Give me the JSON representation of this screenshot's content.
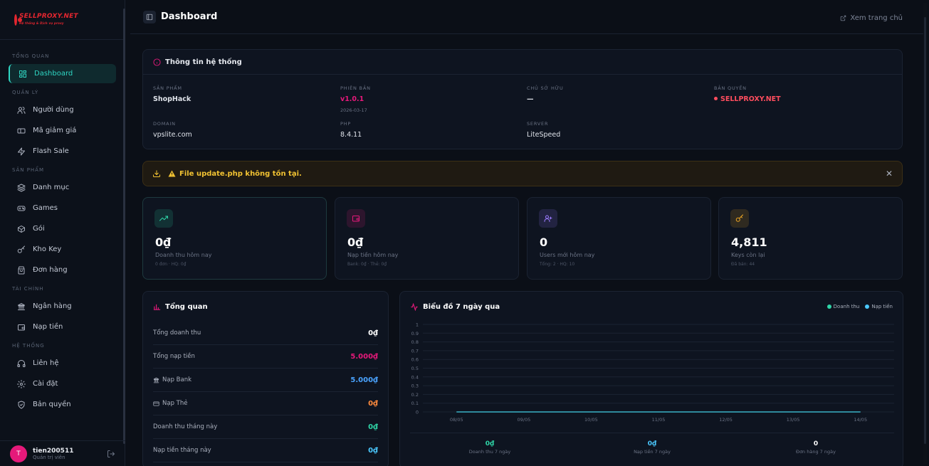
{
  "sidebar": {
    "logo_text": "SELLPROXY.NET",
    "logo_sub": "Hệ thống & Dịch vụ proxy",
    "sections": [
      {
        "title": "TỔNG QUAN",
        "items": [
          {
            "label": "Dashboard",
            "icon": "dashboard-icon",
            "active": true
          }
        ]
      },
      {
        "title": "QUẢN LÝ",
        "items": [
          {
            "label": "Người dùng",
            "icon": "users-icon"
          },
          {
            "label": "Mã giảm giá",
            "icon": "ticket-icon"
          },
          {
            "label": "Flash Sale",
            "icon": "flash-icon"
          }
        ]
      },
      {
        "title": "SẢN PHẨM",
        "items": [
          {
            "label": "Danh mục",
            "icon": "layers-icon"
          },
          {
            "label": "Games",
            "icon": "gamepad-icon"
          },
          {
            "label": "Gói",
            "icon": "package-icon"
          },
          {
            "label": "Kho Key",
            "icon": "key-icon"
          },
          {
            "label": "Đơn hàng",
            "icon": "bag-icon"
          }
        ]
      },
      {
        "title": "TÀI CHÍNH",
        "items": [
          {
            "label": "Ngân hàng",
            "icon": "bank-icon"
          },
          {
            "label": "Nạp tiền",
            "icon": "wallet-icon"
          }
        ]
      },
      {
        "title": "HỆ THỐNG",
        "items": [
          {
            "label": "Liên hệ",
            "icon": "headset-icon"
          },
          {
            "label": "Cài đặt",
            "icon": "gear-icon"
          },
          {
            "label": "Bản quyền",
            "icon": "shield-icon"
          }
        ]
      }
    ],
    "user": {
      "initial": "T",
      "name": "tien200511",
      "role": "Quản trị viên"
    }
  },
  "topbar": {
    "title": "Dashboard",
    "home_link": "Xem trang chủ"
  },
  "info": {
    "title": "Thông tin hệ thống",
    "product_label": "SẢN PHẨM",
    "product": "ShopHack",
    "version_label": "PHIÊN BẢN",
    "version": "v1.0.1",
    "version_date": "2026-03-17",
    "owner_label": "CHỦ SỞ HỮU",
    "owner": "—",
    "license_label": "BẢN QUYỀN",
    "license": "SELLPROXY.NET",
    "domain_label": "DOMAIN",
    "domain": "vpslite.com",
    "php_label": "PHP",
    "php": "8.4.11",
    "server_label": "SERVER",
    "server": "LiteSpeed"
  },
  "alert": {
    "message": "File update.php không tồn tại."
  },
  "stats": [
    {
      "value": "0₫",
      "label": "Doanh thu hôm nay",
      "sub": "0 đơn · HQ: 0₫",
      "icon": "trending-up-icon",
      "color": "#2fd6a8"
    },
    {
      "value": "0₫",
      "label": "Nạp tiền hôm nay",
      "sub": "Bank: 0₫ · Thẻ: 0₫",
      "icon": "wallet-icon",
      "color": "#e5197a"
    },
    {
      "value": "0",
      "label": "Users mới hôm nay",
      "sub": "Tổng: 2 · HQ: 10",
      "icon": "user-plus-icon",
      "color": "#9b7bff"
    },
    {
      "value": "4,811",
      "label": "Keys còn lại",
      "sub": "Đã bán: 44",
      "icon": "key-icon",
      "color": "#f1a824"
    }
  ],
  "overview": {
    "title": "Tổng quan",
    "rows": [
      {
        "label": "Tổng doanh thu",
        "value": "0₫",
        "color": "#ffffff",
        "icon": ""
      },
      {
        "label": "Tổng nạp tiền",
        "value": "5.000₫",
        "color": "#e5197a",
        "icon": ""
      },
      {
        "label": "Nạp Bank",
        "value": "5.000₫",
        "color": "#4aa3ff",
        "icon": "bank-icon"
      },
      {
        "label": "Nạp Thẻ",
        "value": "0₫",
        "color": "#ff8a3d",
        "icon": "card-icon"
      },
      {
        "label": "Doanh thu tháng này",
        "value": "0₫",
        "color": "#2fd6a8",
        "icon": ""
      },
      {
        "label": "Nạp tiền tháng này",
        "value": "0₫",
        "color": "#4ac8ff",
        "icon": ""
      }
    ]
  },
  "chart": {
    "title": "Biểu đồ 7 ngày qua",
    "legend": [
      {
        "name": "Doanh thu",
        "color": "#2fd6a8"
      },
      {
        "name": "Nạp tiền",
        "color": "#4ac8ff"
      }
    ],
    "summary": [
      {
        "value": "0₫",
        "label": "Doanh thu 7 ngày",
        "color": "#2fd6a8"
      },
      {
        "value": "0₫",
        "label": "Nạp tiền 7 ngày",
        "color": "#4ac8ff"
      },
      {
        "value": "0",
        "label": "Đơn hàng 7 ngày",
        "color": "#ffffff"
      }
    ]
  },
  "chart_data": {
    "type": "line",
    "categories": [
      "08/05",
      "09/05",
      "10/05",
      "11/05",
      "12/05",
      "13/05",
      "14/05"
    ],
    "series": [
      {
        "name": "Doanh thu",
        "values": [
          0,
          0,
          0,
          0,
          0,
          0,
          0
        ]
      },
      {
        "name": "Nạp tiền",
        "values": [
          0,
          0,
          0,
          0,
          0,
          0,
          0
        ]
      }
    ],
    "yticks": [
      "1",
      "0.9",
      "0.8",
      "0.7",
      "0.6",
      "0.5",
      "0.4",
      "0.3",
      "0.2",
      "0.1",
      "0"
    ],
    "ylim": [
      0,
      1
    ],
    "title": "Biểu đồ 7 ngày qua",
    "legend_position": "top-right",
    "grid": true
  }
}
